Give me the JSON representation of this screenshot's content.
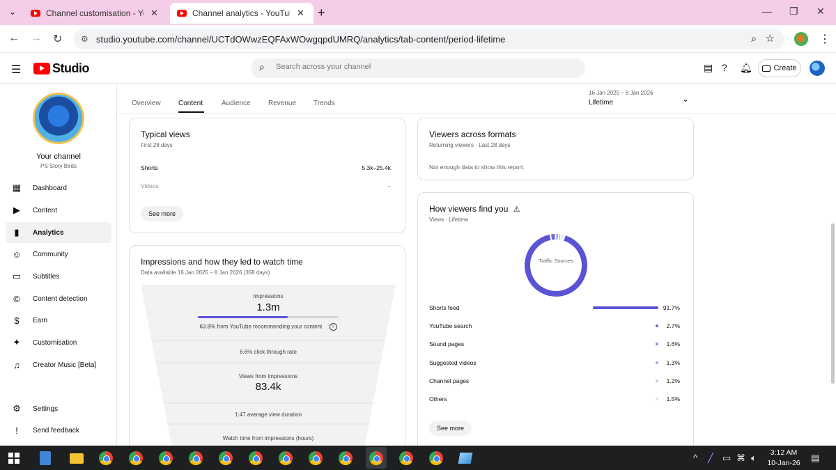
{
  "browser": {
    "tabs": [
      {
        "title": "Channel customisation - YouTube Studio",
        "active": false
      },
      {
        "title": "Channel analytics - YouTube Studio",
        "active": true
      }
    ],
    "url": "studio.youtube.com/channel/UCTdOWwzEQFAxWOwgqpdUMRQ/analytics/tab-content/period-lifetime"
  },
  "studio": {
    "logo_text": "Studio",
    "search_placeholder": "Search across your channel",
    "create_label": "Create"
  },
  "sidebar": {
    "channel_label": "Your channel",
    "channel_name": "PS Story Birds",
    "items": [
      {
        "label": "Dashboard",
        "icon": "dashboard-icon"
      },
      {
        "label": "Content",
        "icon": "content-icon"
      },
      {
        "label": "Analytics",
        "icon": "analytics-icon",
        "active": true
      },
      {
        "label": "Community",
        "icon": "community-icon"
      },
      {
        "label": "Subtitles",
        "icon": "subtitles-icon"
      },
      {
        "label": "Content detection",
        "icon": "copyright-icon"
      },
      {
        "label": "Earn",
        "icon": "dollar-icon"
      },
      {
        "label": "Customisation",
        "icon": "magic-wand-icon"
      },
      {
        "label": "Creator Music [Beta]",
        "icon": "music-icon"
      }
    ],
    "bottom": [
      {
        "label": "Settings",
        "icon": "gear-icon"
      },
      {
        "label": "Send feedback",
        "icon": "feedback-icon"
      }
    ]
  },
  "analytics": {
    "tabs": [
      "Overview",
      "Content",
      "Audience",
      "Revenue",
      "Trends"
    ],
    "selected_tab": "Content",
    "date_range": "16 Jan 2025 – 8 Jan 2026",
    "period": "Lifetime"
  },
  "typical_views": {
    "title": "Typical views",
    "subtitle": "First 28 days",
    "rows": [
      {
        "label": "Shorts",
        "value": "5.3k–25.4k"
      },
      {
        "label": "Videos",
        "value": "–"
      }
    ],
    "see_more": "See more"
  },
  "viewers_formats": {
    "title": "Viewers across formats",
    "subtitle": "Returning viewers · Last 28 days",
    "message": "Not enough data to show this report."
  },
  "impressions": {
    "title": "Impressions and how they led to watch time",
    "subtitle": "Data available 16 Jan 2025 – 8 Jan 2026 (358 days)",
    "impressions_label": "Impressions",
    "impressions_value": "1.3m",
    "recommend_text": "63.8% from YouTube recommending your content",
    "recommend_fraction": 0.638,
    "ctr_text": "6.6% click-through rate",
    "views_label": "Views from impressions",
    "views_value": "83.4k",
    "avd_text": "1:47 average view duration",
    "watch_label": "Watch time from impressions (hours)"
  },
  "traffic": {
    "title": "How viewers find you",
    "subtitle": "Views · Lifetime",
    "donut_label": "Traffic Sources",
    "rows": [
      {
        "label": "Shorts feed",
        "value": "91.7%",
        "pct": 91.7
      },
      {
        "label": "YouTube search",
        "value": "2.7%",
        "pct": 2.7
      },
      {
        "label": "Sound pages",
        "value": "1.6%",
        "pct": 1.6
      },
      {
        "label": "Suggested videos",
        "value": "1.3%",
        "pct": 1.3
      },
      {
        "label": "Channel pages",
        "value": "1.2%",
        "pct": 1.2
      },
      {
        "label": "Others",
        "value": "1.5%",
        "pct": 1.5
      }
    ],
    "see_more": "See more",
    "accent": "#5b53d6"
  },
  "taskbar": {
    "time": "3:12 AM",
    "date": "10-Jan-26"
  }
}
